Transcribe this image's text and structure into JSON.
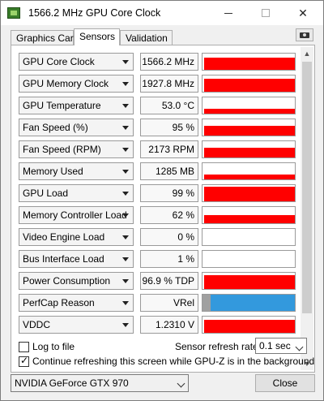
{
  "window": {
    "title": "1566.2 MHz GPU Core Clock"
  },
  "tabs": [
    {
      "label": "Graphics Card"
    },
    {
      "label": "Sensors"
    },
    {
      "label": "Validation"
    }
  ],
  "sensors": [
    {
      "name": "GPU Core Clock",
      "value": "1566.2 MHz",
      "graph_level": 0.75,
      "graph_color": "#ff0000"
    },
    {
      "name": "GPU Memory Clock",
      "value": "1927.8 MHz",
      "graph_level": 0.8,
      "graph_color": "#ff0000"
    },
    {
      "name": "GPU Temperature",
      "value": "53.0 °C",
      "graph_level": 0.3,
      "graph_color": "#ff0000"
    },
    {
      "name": "Fan Speed (%)",
      "value": "95 %",
      "graph_level": 0.6,
      "graph_color": "#ff0000"
    },
    {
      "name": "Fan Speed (RPM)",
      "value": "2173 RPM",
      "graph_level": 0.6,
      "graph_color": "#ff0000"
    },
    {
      "name": "Memory Used",
      "value": "1285 MB",
      "graph_level": 0.3,
      "graph_color": "#ff0000"
    },
    {
      "name": "GPU Load",
      "value": "99 %",
      "graph_level": 0.9,
      "graph_color": "#ff0000"
    },
    {
      "name": "Memory Controller Load",
      "value": "62 %",
      "graph_level": 0.5,
      "graph_color": "#ff0000"
    },
    {
      "name": "Video Engine Load",
      "value": "0 %",
      "graph_level": 0,
      "graph_color": "#ff0000"
    },
    {
      "name": "Bus Interface Load",
      "value": "1 %",
      "graph_level": 0,
      "graph_color": "#ff0000"
    },
    {
      "name": "Power Consumption",
      "value": "96.9 % TDP",
      "graph_level": 0.85,
      "graph_color": "#ff0000"
    },
    {
      "name": "PerfCap Reason",
      "value": "VRel",
      "graph_level": 1,
      "graph_color": "#3399dd"
    },
    {
      "name": "VDDC",
      "value": "1.2310 V",
      "graph_level": 0.8,
      "graph_color": "#ff0000"
    }
  ],
  "options": {
    "log_to_file_label": "Log to file",
    "continue_refreshing_label": "Continue refreshing this screen while GPU-Z is in the background",
    "refresh_rate_label": "Sensor refresh rate:",
    "refresh_rate_value": "0.1 sec"
  },
  "footer": {
    "gpu_name": "NVIDIA GeForce GTX 970",
    "close_label": "Close"
  }
}
